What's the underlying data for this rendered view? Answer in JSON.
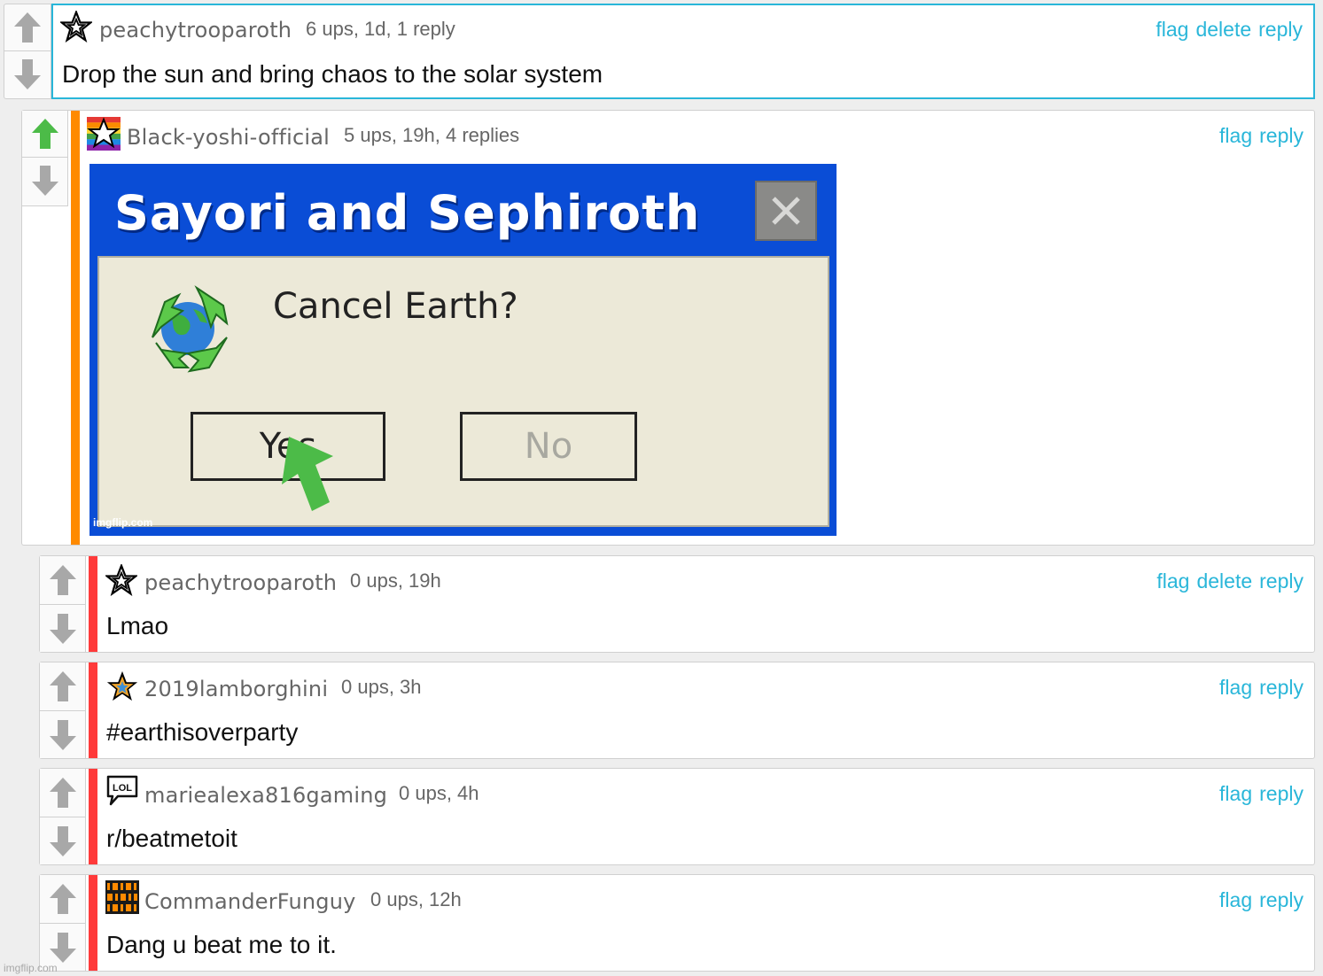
{
  "colors": {
    "link": "#29b6d9",
    "upvoted": "#4cbb48",
    "arrow_gray": "#a8a8a8",
    "bar_orange": "#ff8a00",
    "bar_red": "#ff3a3a",
    "meme_blue": "#0a4dd6"
  },
  "comments": [
    {
      "username": "peachytrooparoth",
      "meta": "6 ups, 1d, 1 reply",
      "actions": [
        "flag",
        "delete",
        "reply"
      ],
      "text": "Drop the sun and bring chaos to the solar system",
      "avatar_icon": "star-icon"
    },
    {
      "username": "Black-yoshi-official",
      "meta": "5 ups, 19h, 4 replies",
      "actions": [
        "flag",
        "reply"
      ],
      "avatar_icon": "rainbow-star-icon",
      "image": {
        "title": "Sayori and Sephiroth",
        "question": "Cancel Earth?",
        "yes_label": "Yes",
        "no_label": "No",
        "credit": "imgflip.com"
      }
    },
    {
      "username": "peachytrooparoth",
      "meta": "0 ups, 19h",
      "actions": [
        "flag",
        "delete",
        "reply"
      ],
      "text": "Lmao",
      "avatar_icon": "star-icon"
    },
    {
      "username": "2019lamborghini",
      "meta": "0 ups, 3h",
      "actions": [
        "flag",
        "reply"
      ],
      "text": "#earthisoverparty",
      "avatar_icon": "rainbow-star-icon"
    },
    {
      "username": "mariealexa816gaming",
      "meta": "0 ups, 4h",
      "actions": [
        "flag",
        "reply"
      ],
      "text": "r/beatmetoit",
      "avatar_icon": "lol-bubble-icon",
      "avatar_text": "LOL"
    },
    {
      "username": "CommanderFunguy",
      "meta": "0 ups, 12h",
      "actions": [
        "flag",
        "reply"
      ],
      "text": "Dang u beat me to it.",
      "avatar_icon": "binary-avatar-icon"
    }
  ],
  "watermark": "imgflip.com"
}
